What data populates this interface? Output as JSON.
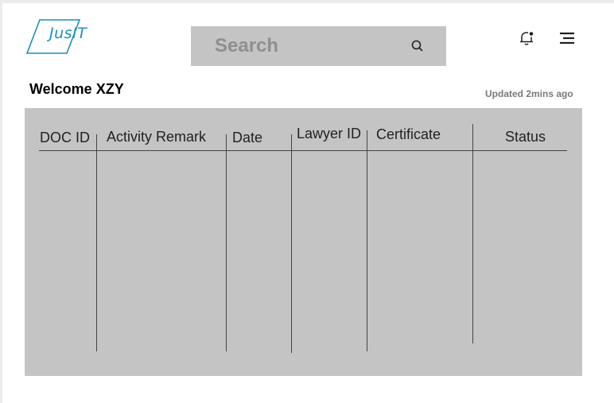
{
  "header": {
    "logo_text": "JusIT",
    "search": {
      "placeholder": "Search"
    },
    "icons": [
      "search-icon",
      "bell-icon",
      "menu-icon"
    ]
  },
  "main": {
    "welcome": "Welcome XZY",
    "updated": "Updated 2mins ago",
    "table": {
      "columns": [
        "DOC ID",
        "Activity Remark",
        "Date",
        "Lawyer ID",
        "Certificate",
        "Status"
      ],
      "rows": []
    }
  },
  "colors": {
    "panel": "#c4c4c4",
    "logo": "#1a8fc4",
    "muted_text": "#7a7a7a"
  }
}
